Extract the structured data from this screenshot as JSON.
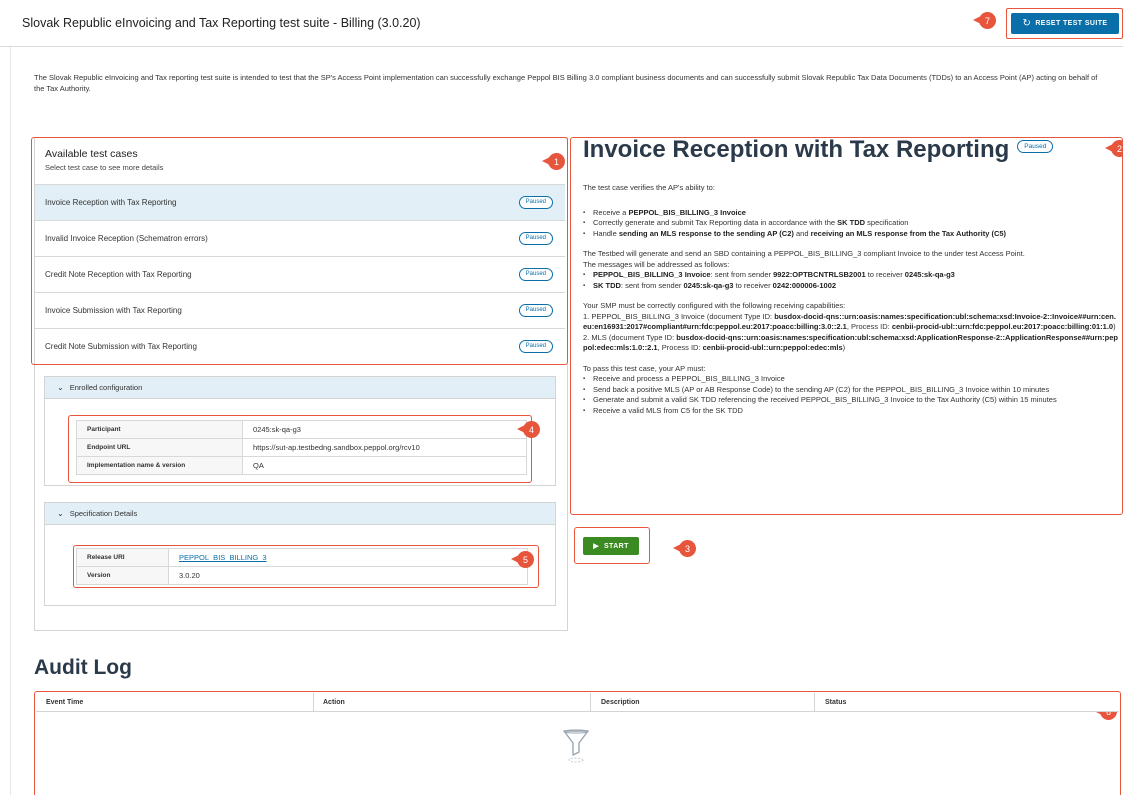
{
  "header": {
    "title": "Slovak Republic eInvoicing and Tax Reporting test suite - Billing (3.0.20)",
    "reset_label": "RESET TEST SUITE",
    "reset_icon": "refresh-icon"
  },
  "intro": "The Slovak Republic eInvoicing and Tax reporting test suite is intended to test that the SP's Access Point implementation can successfully exchange Peppol BIS Billing 3.0 compliant business documents and can successfully submit Slovak Republic Tax Data Documents (TDDs) to an Access Point (AP) acting on behalf of the Tax Authority.",
  "test_cases": {
    "title": "Available test cases",
    "subtitle": "Select test case to see more details",
    "items": [
      {
        "label": "Invoice Reception with Tax Reporting",
        "status": "Paused"
      },
      {
        "label": "Invalid Invoice Reception (Schematron errors)",
        "status": "Paused"
      },
      {
        "label": "Credit Note Reception with Tax Reporting",
        "status": "Paused"
      },
      {
        "label": "Invoice Submission with Tax Reporting",
        "status": "Paused"
      },
      {
        "label": "Credit Note Submission with Tax Reporting",
        "status": "Paused"
      }
    ]
  },
  "enrolled": {
    "title": "Enrolled configuration",
    "rows": [
      {
        "key": "Participant",
        "value": "0245:sk-qa-g3"
      },
      {
        "key": "Endpoint URL",
        "value": "https://sut-ap.testbedng.sandbox.peppol.org/rcv10"
      },
      {
        "key": "Implementation name & version",
        "value": "QA"
      }
    ]
  },
  "spec": {
    "title": "Specification Details",
    "rows": [
      {
        "key": "Release URI",
        "value": "PEPPOL_BIS_BILLING_3"
      },
      {
        "key": "Version",
        "value": "3.0.20"
      }
    ]
  },
  "detail": {
    "title": "Invoice Reception with Tax Reporting",
    "status": "Paused",
    "intro": "The test case verifies the AP's ability to:",
    "ability": {
      "b1_pre": "Receive a ",
      "b1_b": "PEPPOL_BIS_BILLING_3 Invoice",
      "b2_pre": "Correctly generate and submit Tax Reporting data in accordance with the ",
      "b2_b": "SK TDD",
      "b2_post": " specification",
      "b3_pre": "Handle ",
      "b3_b1": "sending an MLS response to the sending AP (C2)",
      "b3_mid": " and ",
      "b3_b2": "receiving an MLS response from the Tax Authority (C5)"
    },
    "testbed": "The Testbed will generate and send an SBD containing a PEPPOL_BIS_BILLING_3 compliant Invoice to the under test Access Point.",
    "addressed": "The messages will be addressed as follows:",
    "msg": {
      "m1_b": "PEPPOL_BIS_BILLING_3 Invoice",
      "m1_a": ": sent from sender ",
      "m1_b2": "9922:OPTBCNTRLSB2001",
      "m1_c": " to receiver ",
      "m1_b3": "0245:sk-qa-g3",
      "m2_b": "SK TDD",
      "m2_a": ": sent from sender ",
      "m2_b2": "0245:sk-qa-g3",
      "m2_c": " to receiver ",
      "m2_b3": "0242:000006-1002"
    },
    "smp": "Your SMP must be correctly configured with the following receiving capabilities:",
    "cap": {
      "c1_pre": "1. PEPPOL_BIS_BILLING_3 Invoice (document Type ID: ",
      "c1_b1": "busdox-docid-qns::urn:oasis:names:specification:ubl:schema:xsd:Invoice-2::Invoice##urn:cen.eu:en16931:2017#compliant#urn:fdc:peppol.eu:2017:poacc:billing:3.0::2.1",
      "c1_mid": ", Process ID: ",
      "c1_b2": "cenbii-procid-ubl::urn:fdc:peppol.eu:2017:poacc:billing:01:1.0",
      "c1_end": ")",
      "c2_pre": "2. MLS (document Type ID: ",
      "c2_b1": "busdox-docid-qns::urn:oasis:names:specification:ubl:schema:xsd:ApplicationResponse-2::ApplicationResponse##urn:peppol:edec:mls:1.0::2.1",
      "c2_mid": ", Process ID: ",
      "c2_b2": "cenbii-procid-ubl::urn:peppol:edec:mls",
      "c2_end": ")"
    },
    "pass_intro": "To pass this test case, your AP must:",
    "pass_items": [
      "Receive and process a PEPPOL_BIS_BILLING_3 Invoice",
      "Send back a positive MLS (AP or AB Response Code) to the sending AP (C2) for the PEPPOL_BIS_BILLING_3 Invoice within 10 minutes",
      "Generate and submit a valid SK TDD referencing the received PEPPOL_BIS_BILLING_3 Invoice to the Tax Authority (C5) within 15 minutes",
      "Receive a valid MLS from C5 for the SK TDD"
    ]
  },
  "start_label": "START",
  "audit": {
    "title": "Audit Log",
    "columns": [
      "Event Time",
      "Action",
      "Description",
      "Status"
    ],
    "empty_icon": "empty-filter-icon"
  },
  "markers": [
    "1",
    "2",
    "3",
    "4",
    "5",
    "6",
    "7"
  ],
  "colors": {
    "marker": "#e8553d",
    "primary": "#0a6fa8",
    "start": "#3c8a22",
    "selected_row": "#e2eff7"
  }
}
